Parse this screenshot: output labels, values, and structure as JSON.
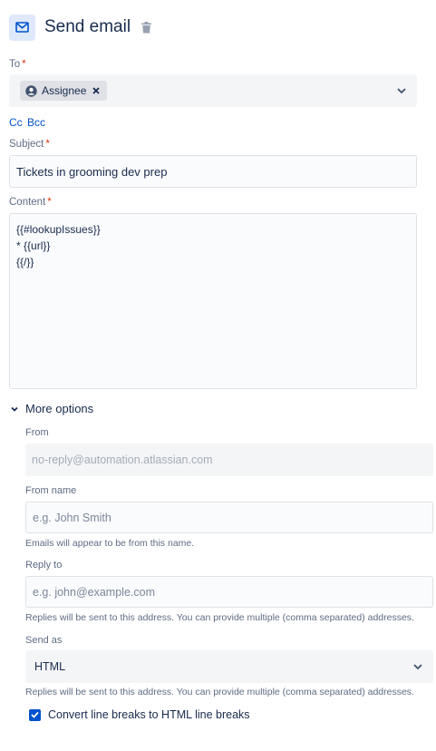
{
  "header": {
    "title": "Send email",
    "icon": "mail-icon",
    "delete_icon": "trash-icon",
    "accent": "#0052cc"
  },
  "to": {
    "label": "To",
    "required_mark": "*",
    "chip_label": "Assignee",
    "chip_icon": "user-avatar-icon",
    "remove_icon": "close-icon",
    "dropdown_icon": "chevron-down-icon"
  },
  "cc_label": "Cc",
  "bcc_label": "Bcc",
  "subject": {
    "label": "Subject",
    "required_mark": "*",
    "value": "Tickets in grooming dev prep"
  },
  "content": {
    "label": "Content",
    "required_mark": "*",
    "lines": [
      "{{#lookupIssues}}",
      "* {{url}}",
      "{{/}}"
    ]
  },
  "more_options": {
    "label": "More options",
    "from": {
      "label": "From",
      "placeholder": "no-reply@automation.atlassian.com"
    },
    "from_name": {
      "label": "From name",
      "placeholder": "e.g. John Smith",
      "help": "Emails will appear to be from this name."
    },
    "reply_to": {
      "label": "Reply to",
      "placeholder": "e.g. john@example.com",
      "help": "Replies will be sent to this address. You can provide multiple (comma separated) addresses."
    },
    "send_as": {
      "label": "Send as",
      "value": "HTML",
      "help": "Replies will be sent to this address. You can provide multiple (comma separated) addresses."
    },
    "convert_line_breaks": {
      "label": "Convert line breaks to HTML line breaks",
      "checked": true
    }
  },
  "colors": {
    "text": "#172b4d",
    "subtle": "#5e6c84",
    "required": "#de350b",
    "link": "#0052cc",
    "field_bg": "#f4f5f7"
  }
}
